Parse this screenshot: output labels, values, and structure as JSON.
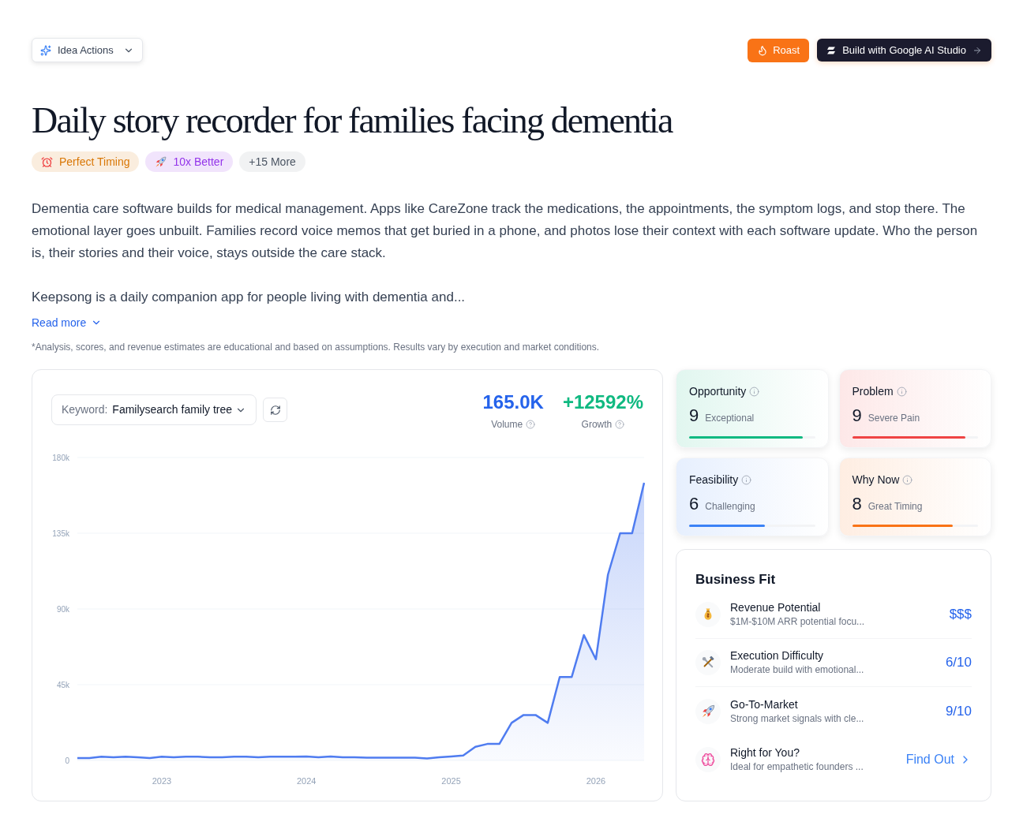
{
  "header": {
    "menu_button": {
      "label": "Idea Actions"
    },
    "buttons": [
      {
        "kind": "roast",
        "label": "Roast"
      },
      {
        "kind": "build",
        "label": "Build with Google AI Studio"
      }
    ]
  },
  "title": "Daily story recorder for families facing dementia",
  "tags": [
    {
      "kind": "badge",
      "label": "Perfect Timing",
      "color": "#d97706"
    },
    {
      "kind": "badge",
      "label": "10x Better",
      "color": "#9333ea"
    },
    {
      "kind": "more",
      "label": "+15 More",
      "color": "#4b5563"
    }
  ],
  "description": [
    "Dementia care software builds for medical management. Apps like CareZone track the medications, the appointments, the symptom logs, and stop there. The emotional layer goes unbuilt. Families record voice memos that get buried in a phone, and photos lose their context with each software update. Who the person is, their stories and their voice, stays outside the care stack.",
    "Keepsong is a daily companion app for people living with dementia and..."
  ],
  "read_more": {
    "label": "Read more"
  },
  "disclaimer": "*Analysis, scores, and revenue estimates are educational and based on assumptions. Results vary by execution and market conditions.",
  "trend": {
    "keyword": {
      "label": "Keyword:",
      "value": "Familysearch family tree"
    },
    "stats": [
      {
        "value": "165.0K",
        "label": "Volume",
        "color": "#2563eb"
      },
      {
        "value": "+12592%",
        "label": "Growth",
        "color": "#10b981"
      }
    ],
    "chart_data": {
      "type": "area",
      "grid": true,
      "x": [
        2022.417,
        2022.5,
        2022.583,
        2022.667,
        2022.75,
        2022.833,
        2022.917,
        2023,
        2023.083,
        2023.167,
        2023.25,
        2023.333,
        2023.417,
        2023.5,
        2023.583,
        2023.667,
        2023.75,
        2023.833,
        2023.917,
        2024,
        2024.083,
        2024.167,
        2024.25,
        2024.333,
        2024.417,
        2024.5,
        2024.583,
        2024.667,
        2024.75,
        2024.833,
        2024.917,
        2025,
        2025.083,
        2025.167,
        2025.25,
        2025.333,
        2025.417,
        2025.5,
        2025.583,
        2025.667,
        2025.75,
        2025.833,
        2025.917,
        2026,
        2026.083,
        2026.167,
        2026.25,
        2026.333
      ],
      "series": [
        {
          "color": "#4f7cf0",
          "values": [
            1400,
            1400,
            2200,
            1900,
            2200,
            1900,
            1400,
            2200,
            1900,
            2200,
            2200,
            1900,
            1900,
            2200,
            2200,
            1900,
            2200,
            2200,
            2200,
            2400,
            1900,
            2400,
            1900,
            1900,
            1700,
            1700,
            1700,
            1700,
            1700,
            1200,
            1900,
            2400,
            2900,
            8100,
            9800,
            9800,
            22300,
            27000,
            27000,
            22300,
            49600,
            49600,
            74500,
            60100,
            110400,
            135000,
            135000,
            165000
          ]
        }
      ],
      "xlim": [
        2022.417,
        2026.333
      ],
      "ylim": [
        0,
        180000
      ],
      "yticks": [
        0,
        {
          "value": 45000,
          "label": "45k"
        },
        {
          "value": 90000,
          "label": "90k"
        },
        {
          "value": 135000,
          "label": "135k"
        },
        {
          "value": 180000,
          "label": "180k"
        }
      ],
      "xticks": [
        2023,
        2024,
        2025,
        2026
      ]
    }
  },
  "scores": [
    {
      "label": "Opportunity",
      "score": "9",
      "rating": "Exceptional",
      "level": 0.9,
      "color": "#10b981"
    },
    {
      "label": "Problem",
      "score": "9",
      "rating": "Severe Pain",
      "level": 0.9,
      "color": "#ef4444"
    },
    {
      "label": "Feasibility",
      "score": "6",
      "rating": "Challenging",
      "level": 0.6,
      "color": "#3b82f6"
    },
    {
      "label": "Why Now",
      "score": "8",
      "rating": "Great Timing",
      "level": 0.8,
      "color": "#f97316"
    }
  ],
  "business_fit": {
    "title": "Business Fit",
    "items": [
      {
        "kind": "metric",
        "title": "Revenue Potential",
        "detail": "$1M-$10M ARR potential focu...",
        "value": "$$$"
      },
      {
        "kind": "metric",
        "title": "Execution Difficulty",
        "detail": "Moderate build with emotional...",
        "value": "6/10"
      },
      {
        "kind": "metric",
        "title": "Go-To-Market",
        "detail": "Strong market signals with cle...",
        "value": "9/10"
      },
      {
        "kind": "link",
        "title": "Right for You?",
        "detail": "Ideal for empathetic founders ...",
        "link": "Find Out"
      }
    ]
  }
}
